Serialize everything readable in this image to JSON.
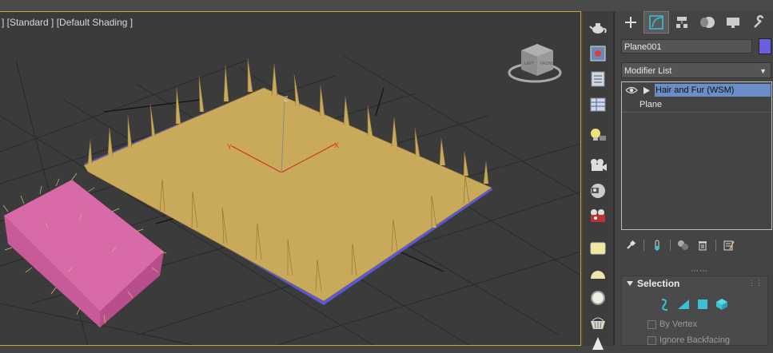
{
  "viewport": {
    "label": "] [Standard ] [Default Shading ]",
    "viewcube_faces": [
      "LEFT",
      "FRONT"
    ],
    "axis_labels": {
      "x": "X",
      "y": "Y",
      "z": "Z"
    }
  },
  "toolbar": {
    "icons": [
      "teapot-render-icon",
      "render-frame-icon",
      "render-setup-icon",
      "render-table-icon",
      "light-icon",
      "camera-icon",
      "camera-setup-icon",
      "camera-shot-icon",
      "rectangle-tool-icon",
      "dome-icon",
      "sphere-icon",
      "basket-icon",
      "cone-icon"
    ]
  },
  "command_panel": {
    "tabs": [
      {
        "icon": "create-icon",
        "active": false
      },
      {
        "icon": "modify-icon",
        "active": true
      },
      {
        "icon": "hierarchy-icon",
        "active": false
      },
      {
        "icon": "motion-icon",
        "active": false
      },
      {
        "icon": "display-icon",
        "active": false
      },
      {
        "icon": "utilities-icon",
        "active": false
      }
    ],
    "object_name": "Plane001",
    "object_color": "#6a5fe0",
    "modifier_list_label": "Modifier List",
    "stack": {
      "items": [
        {
          "label": "Hair and Fur (WSM)",
          "selected": true
        },
        {
          "label": "Plane",
          "selected": false
        }
      ]
    },
    "selection_rollout": {
      "title": "Selection",
      "options": [
        "By Vertex",
        "Ignore Backfacing"
      ]
    }
  },
  "colors": {
    "viewport_border": "#c8a23a",
    "selected_modifier": "#6a8fc8",
    "grass": "#c9a95a",
    "plane_blue": "#5a58d8",
    "fur_pink": "#d86aa8",
    "accent_cyan": "#3cc0d8"
  }
}
